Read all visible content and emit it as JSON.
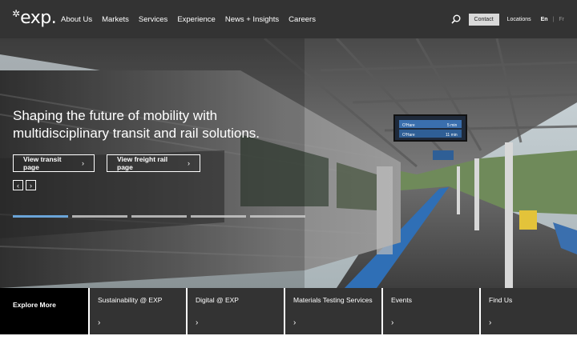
{
  "nav": {
    "logo_text": "exp.",
    "logo_mark": "✲",
    "menu": [
      "About Us",
      "Markets",
      "Services",
      "Experience",
      "News + Insights",
      "Careers"
    ],
    "contact_label": "Contact",
    "locations_label": "Locations",
    "lang_en": "En",
    "lang_sep": "|",
    "lang_fr": "Fr",
    "search_icon": "search-icon"
  },
  "hero": {
    "title": "Shaping the future of mobility with multidisciplinary transit and rail solutions.",
    "transit_label": "View transit page",
    "freight_label": "View freight rail page",
    "chev": "›",
    "prev": "‹",
    "next": "›",
    "slides_count": 5,
    "active_slide": 1,
    "accent_color": "#6aa4d8",
    "sign_lines": [
      "O'Hare",
      "O'Hare",
      "5 min",
      "11 min"
    ]
  },
  "strip": {
    "first": "Explore More",
    "cards": [
      "Sustainability @ EXP",
      "Digital @ EXP",
      "Materials Testing Services",
      "Events",
      "Find Us"
    ],
    "chev": "›"
  },
  "colors": {
    "nav_bg": "#333333",
    "strip_bg": "#333333",
    "explore_bg": "#000000"
  }
}
